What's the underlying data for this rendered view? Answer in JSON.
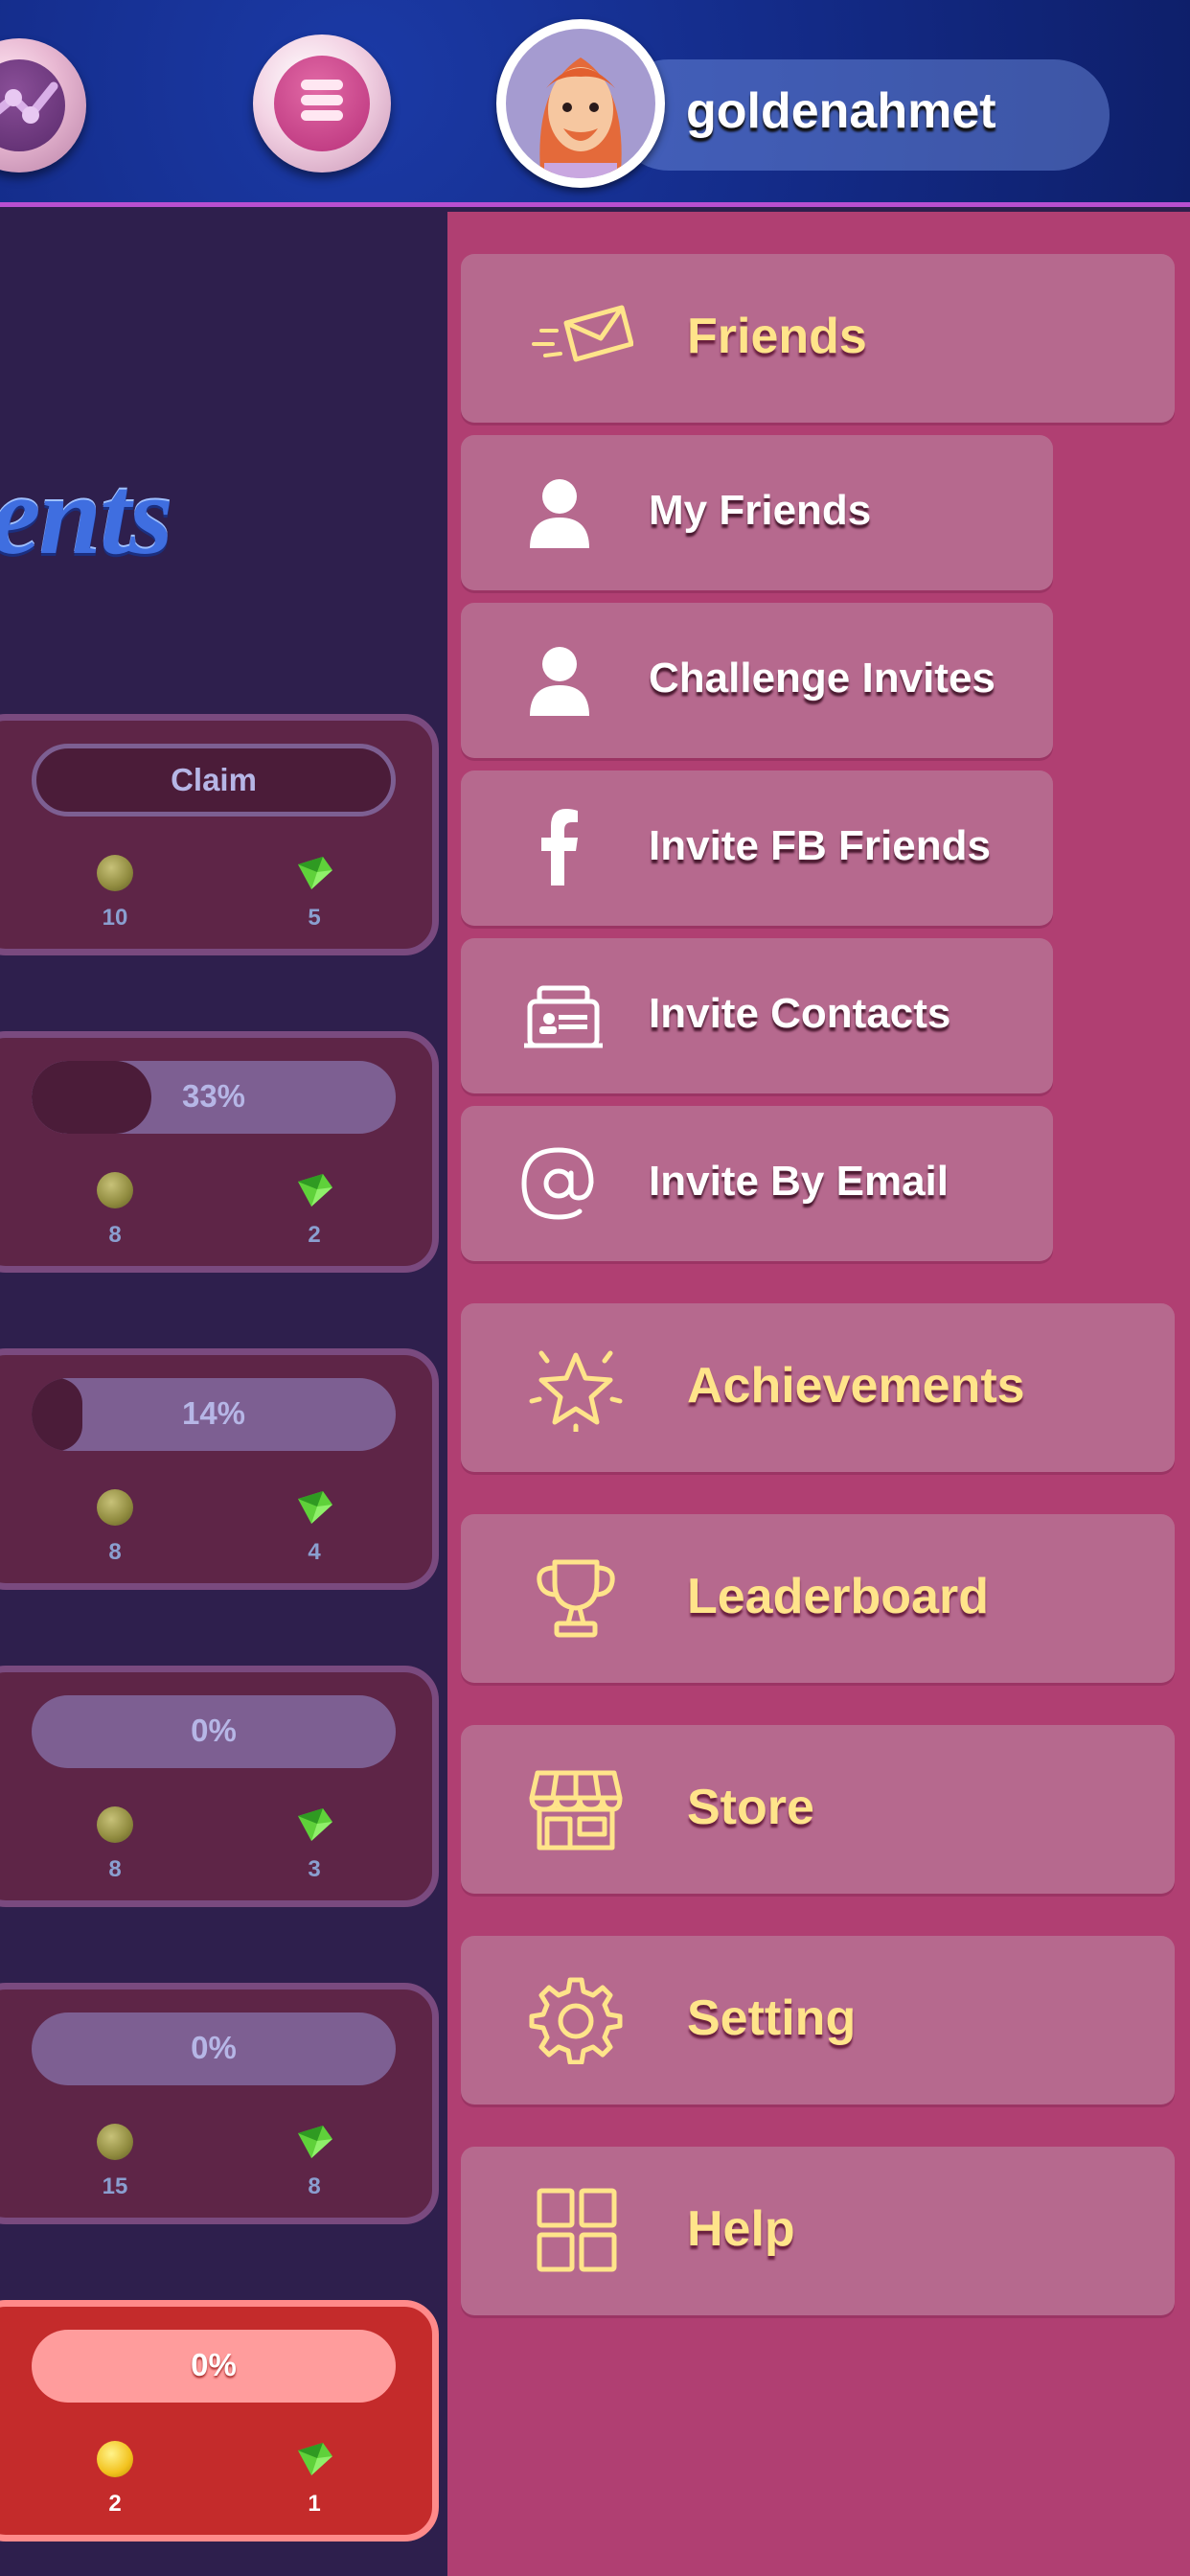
{
  "header": {
    "username": "goldenahmet",
    "buttons": {
      "stats_icon": "network-icon",
      "menu_icon": "menu-icon"
    }
  },
  "left_panel": {
    "title_partial": "ents",
    "achievements": [
      {
        "status": "Claim",
        "progress_percent": 100,
        "coins": "10",
        "gems": "5",
        "highlight": false
      },
      {
        "status": "33%",
        "progress_percent": 33,
        "coins": "8",
        "gems": "2",
        "highlight": false
      },
      {
        "status": "14%",
        "progress_percent": 14,
        "coins": "8",
        "gems": "4",
        "highlight": false
      },
      {
        "status": "0%",
        "progress_percent": 0,
        "coins": "8",
        "gems": "3",
        "highlight": false
      },
      {
        "status": "0%",
        "progress_percent": 0,
        "coins": "15",
        "gems": "8",
        "highlight": false
      },
      {
        "status": "0%",
        "progress_percent": 0,
        "coins": "2",
        "gems": "1",
        "highlight": true
      }
    ]
  },
  "menu": {
    "friends": {
      "label": "Friends",
      "icon": "envelope-icon"
    },
    "friend_items": [
      {
        "label": "My Friends",
        "icon": "user-icon"
      },
      {
        "label": "Challenge Invites",
        "icon": "user-icon"
      },
      {
        "label": "Invite FB Friends",
        "icon": "facebook-icon"
      },
      {
        "label": "Invite Contacts",
        "icon": "contacts-icon"
      },
      {
        "label": "Invite By Email",
        "icon": "at-icon"
      }
    ],
    "achievements": {
      "label": "Achievements",
      "icon": "star-icon"
    },
    "leaderboard": {
      "label": "Leaderboard",
      "icon": "trophy-icon"
    },
    "store": {
      "label": "Store",
      "icon": "store-icon"
    },
    "setting": {
      "label": "Setting",
      "icon": "gear-icon"
    },
    "help": {
      "label": "Help",
      "icon": "grid-icon"
    }
  },
  "colors": {
    "menu_bg": "#b03f72",
    "menu_button": "#b6698e",
    "menu_main_text": "#ffe48a",
    "left_bg": "#2e1f4d",
    "card_bg": "#5e2547",
    "highlight_card": "#c42b2b"
  }
}
